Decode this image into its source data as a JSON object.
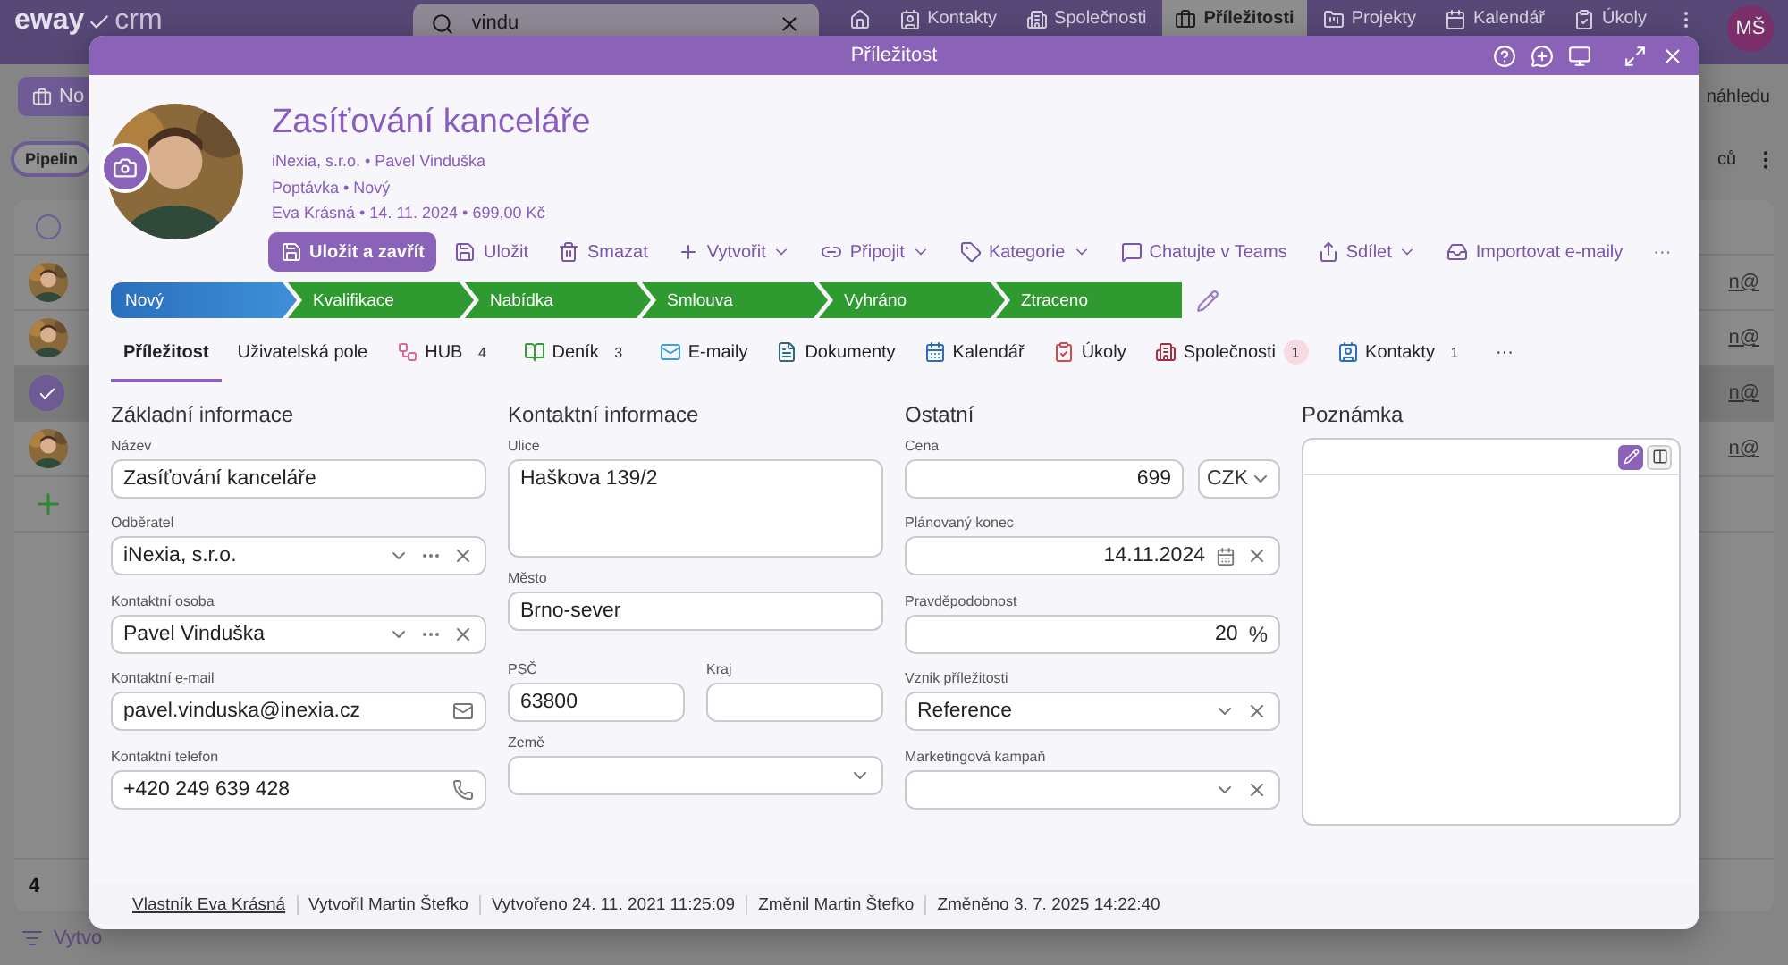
{
  "app": {
    "logo": "eway",
    "logo_suffix": "crm",
    "search": {
      "value": "vindu"
    },
    "nav": [
      {
        "label": "Kontakty",
        "selected": false
      },
      {
        "label": "Společnosti",
        "selected": false
      },
      {
        "label": "Příležitosti",
        "selected": true
      },
      {
        "label": "Projekty",
        "selected": false
      },
      {
        "label": "Kalendář",
        "selected": false
      },
      {
        "label": "Úkoly",
        "selected": false
      }
    ],
    "user": "MŠ",
    "new_button": "No",
    "pipeline_chip": "Pipelin",
    "preview_label": "náhledu",
    "columns_label": "ců",
    "rows": [
      {
        "kind": "header",
        "selected": false
      },
      {
        "kind": "item",
        "selected": false,
        "email": "n@"
      },
      {
        "kind": "item",
        "selected": false,
        "email": "n@"
      },
      {
        "kind": "item",
        "selected": true,
        "email": "n@"
      },
      {
        "kind": "item",
        "selected": false,
        "email": "n@"
      },
      {
        "kind": "add"
      }
    ],
    "count": "4",
    "filter": "Vytvo"
  },
  "dialog": {
    "title": "Příležitost",
    "record": {
      "title": "Zasíťování kanceláře",
      "meta": [
        "iNexia, s.r.o. • Pavel Vinduška",
        "Poptávka • Nový",
        "Eva Krásná • 14. 11. 2024 • 699,00 Kč"
      ]
    },
    "toolbar": [
      {
        "label": "Uložit a zavřít",
        "kind": "primary",
        "dropdown": false
      },
      {
        "label": "Uložit",
        "kind": "plain",
        "dropdown": false
      },
      {
        "label": "Smazat",
        "kind": "plain",
        "dropdown": false
      },
      {
        "label": "Vytvořit",
        "kind": "plain",
        "dropdown": true
      },
      {
        "label": "Připojit",
        "kind": "plain",
        "dropdown": true
      },
      {
        "label": "Kategorie",
        "kind": "plain",
        "dropdown": true
      },
      {
        "label": "Chatujte v Teams",
        "kind": "plain",
        "dropdown": false
      },
      {
        "label": "Sdílet",
        "kind": "plain",
        "dropdown": true
      },
      {
        "label": "Importovat e-maily",
        "kind": "plain",
        "dropdown": false
      },
      {
        "label": "···",
        "kind": "more",
        "dropdown": false
      }
    ],
    "stages": [
      {
        "label": "Nový",
        "selected": true,
        "color": "#2a6fbd"
      },
      {
        "label": "Kvalifikace",
        "selected": false,
        "color": "#2f9a2f"
      },
      {
        "label": "Nabídka",
        "selected": false,
        "color": "#2f9a2f"
      },
      {
        "label": "Smlouva",
        "selected": false,
        "color": "#2f9a2f"
      },
      {
        "label": "Vyhráno",
        "selected": false,
        "color": "#2f9a2f"
      },
      {
        "label": "Ztraceno",
        "selected": false,
        "color": "#2f9a2f"
      }
    ],
    "tabs": [
      {
        "label": "Příležitost",
        "selected": true
      },
      {
        "label": "Uživatelská pole",
        "selected": false
      },
      {
        "label": "HUB",
        "count": "4",
        "alert": false,
        "selected": false
      },
      {
        "label": "Deník",
        "count": "3",
        "alert": false,
        "selected": false
      },
      {
        "label": "E-maily",
        "selected": false
      },
      {
        "label": "Dokumenty",
        "selected": false
      },
      {
        "label": "Kalendář",
        "selected": false
      },
      {
        "label": "Úkoly",
        "selected": false
      },
      {
        "label": "Společnosti",
        "count": "1",
        "alert": true,
        "selected": false
      },
      {
        "label": "Kontakty",
        "count": "1",
        "alert": false,
        "selected": false
      },
      {
        "label": "···",
        "selected": false
      }
    ],
    "sections": [
      {
        "title": "Základní informace",
        "fields": [
          {
            "label": "Název",
            "kind": "text",
            "value": "Zasíťování kanceláře"
          },
          {
            "label": "Odběratel",
            "kind": "lookup",
            "value": "iNexia, s.r.o."
          },
          {
            "label": "Kontaktní osoba",
            "kind": "lookup",
            "value": "Pavel Vinduška"
          },
          {
            "label": "Kontaktní e-mail",
            "kind": "email",
            "value": "pavel.vinduska@inexia.cz"
          },
          {
            "label": "Kontaktní telefon",
            "kind": "phone",
            "value": "+420 249 639 428"
          }
        ]
      },
      {
        "title": "Kontaktní informace",
        "fields": [
          {
            "label": "Ulice",
            "kind": "textarea",
            "value": "Haškova 139/2"
          },
          {
            "label": "Město",
            "kind": "text",
            "value": "Brno-sever"
          },
          {
            "kind": "pair",
            "fields": [
              {
                "label": "PSČ",
                "kind": "text",
                "value": "63800"
              },
              {
                "label": "Kraj",
                "kind": "text"
              }
            ]
          },
          {
            "label": "Země",
            "kind": "select",
            "clearable": false
          }
        ]
      },
      {
        "title": "Ostatní",
        "fields": [
          {
            "label": "Cena",
            "kind": "money",
            "value": "699",
            "currency": "CZK"
          },
          {
            "label": "Plánovaný konec",
            "kind": "date",
            "value": "14.11.2024"
          },
          {
            "label": "Pravděpodobnost",
            "kind": "percent",
            "value": "20",
            "suffix": "%"
          },
          {
            "label": "Vznik příležitosti",
            "kind": "select",
            "clearable": true,
            "value": "Reference"
          },
          {
            "label": "Marketingová kampaň",
            "kind": "select",
            "clearable": true
          }
        ]
      }
    ],
    "note": {
      "title": "Poznámka",
      "modes": [
        {
          "selected": true
        },
        {
          "selected": false
        }
      ]
    },
    "footer": [
      {
        "text": "Vlastník Eva Krásná",
        "kind": "link"
      },
      {
        "text": "Vytvořil Martin Štefko",
        "kind": "text"
      },
      {
        "text": "Vytvořeno 24. 11. 2021 11:25:09",
        "kind": "text"
      },
      {
        "text": "Změnil Martin Štefko",
        "kind": "text"
      },
      {
        "text": "Změněno 3. 7. 2025 14:22:40",
        "kind": "text"
      }
    ]
  }
}
